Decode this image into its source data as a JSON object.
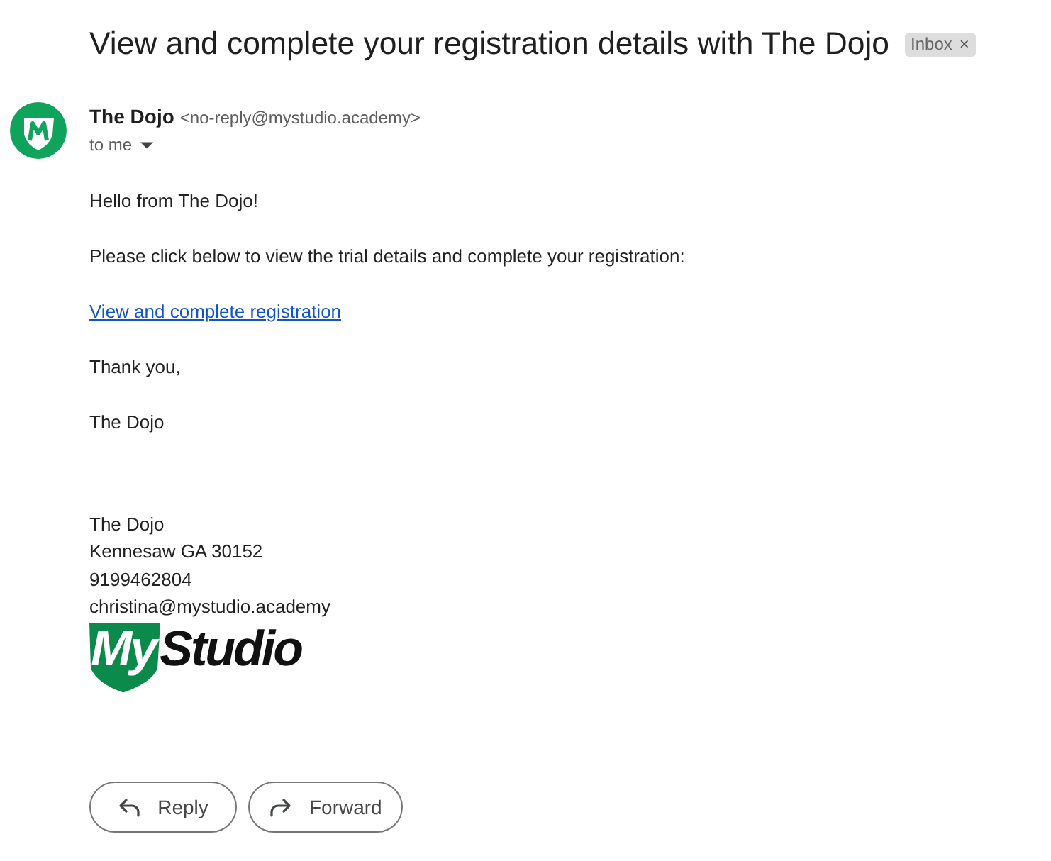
{
  "subject": {
    "title": "View and complete your registration details with The Dojo",
    "label": {
      "text": "Inbox",
      "remove": "×"
    }
  },
  "sender": {
    "name": "The Dojo",
    "email": "<no-reply@mystudio.academy>",
    "recipient": "to me"
  },
  "body": [
    {
      "kind": "text",
      "text": "Hello from The Dojo!"
    },
    {
      "kind": "text",
      "text": "Please click below to view the trial details and complete your registration:"
    },
    {
      "kind": "link",
      "text": "View and complete registration"
    },
    {
      "kind": "text",
      "text": "Thank you,"
    },
    {
      "kind": "text",
      "text": "The Dojo"
    }
  ],
  "signature": {
    "lines": [
      "The Dojo",
      "Kennesaw GA 30152",
      "9199462804",
      "christina@mystudio.academy"
    ],
    "logo": [
      "My",
      "Studio"
    ]
  },
  "actions": [
    {
      "kind": "reply",
      "label": "Reply"
    },
    {
      "kind": "forward",
      "label": "Forward"
    }
  ]
}
